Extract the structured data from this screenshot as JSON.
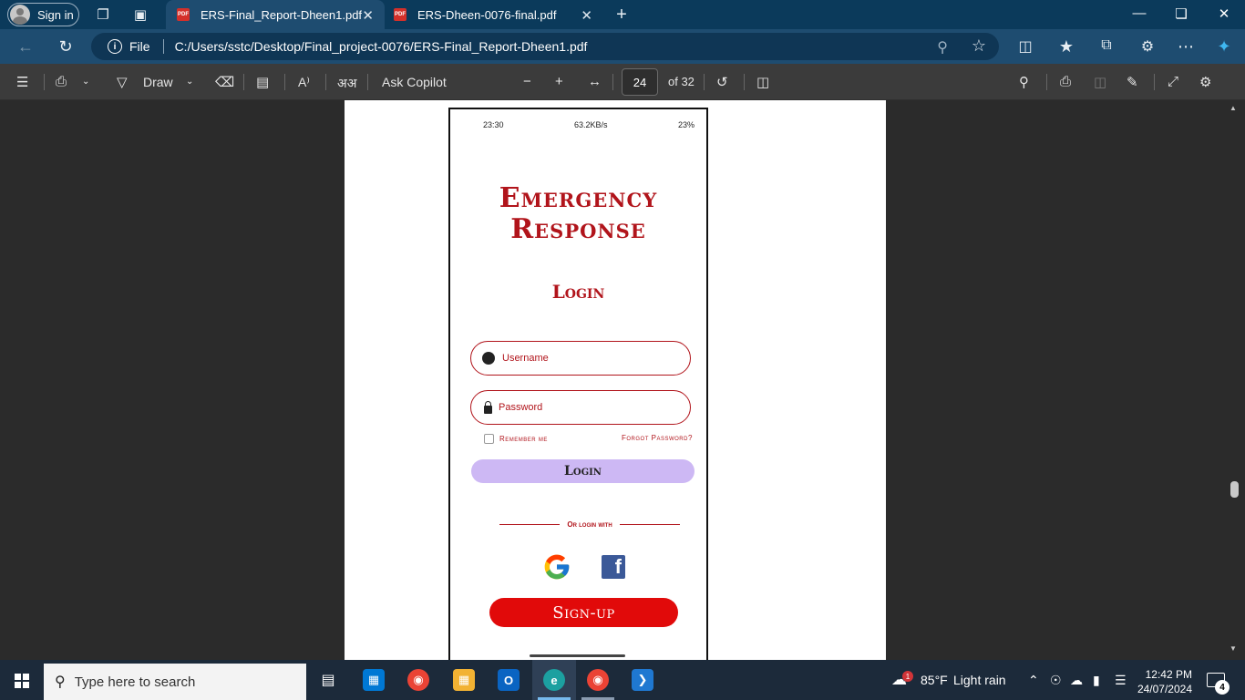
{
  "browser": {
    "signin_label": "Sign in",
    "tabs": [
      {
        "title": "ERS-Final_Report-Dheen1.pdf",
        "active": true
      },
      {
        "title": "ERS-Dheen-0076-final.pdf",
        "active": false
      }
    ],
    "address": {
      "scheme_label": "File",
      "url": "C:/Users/sstc/Desktop/Final_project-0076/ERS-Final_Report-Dheen1.pdf"
    }
  },
  "pdf_toolbar": {
    "draw_label": "Draw",
    "ask_copilot_label": "Ask Copilot",
    "current_page": "24",
    "total_pages_label": "of 32",
    "read_aloud_glyph": "A⁾",
    "translate_glyph": "अअ"
  },
  "phone": {
    "status_time": "23:30",
    "status_right": "63.2KB/s",
    "battery": "23%",
    "title_line1": "Emergency",
    "title_line2": "Response",
    "login_heading": "Login",
    "username_placeholder": "Username",
    "password_placeholder": "Password",
    "remember_label": "Remember me",
    "forgot_label": "Forgot Password?",
    "login_button": "Login",
    "or_login_with": "Or login with",
    "google_letter": "G",
    "facebook_letter": "f",
    "signup_button": "Sign-up"
  },
  "taskbar": {
    "search_placeholder": "Type here to search",
    "weather_temp": "85°F",
    "weather_desc": "Light rain",
    "weather_badge": "1",
    "time": "12:42 PM",
    "date": "24/07/2024",
    "notification_count": "4"
  },
  "colors": {
    "accent_red": "#b1141b",
    "signup_red": "#e10a0a",
    "login_lavender": "#cdb8f4",
    "titlebar": "#0b3a5b"
  }
}
